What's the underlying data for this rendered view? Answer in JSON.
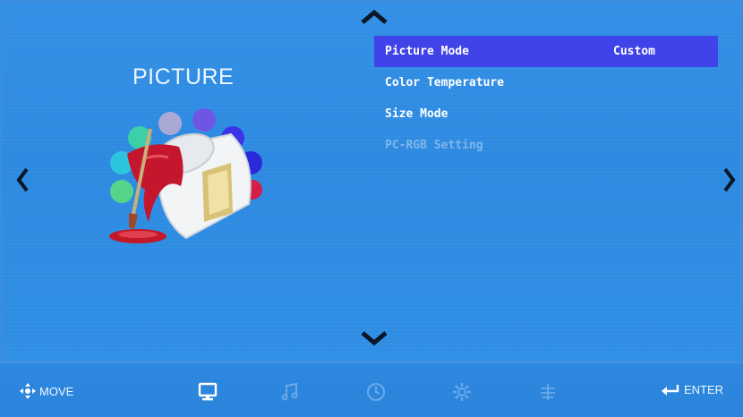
{
  "screen": {
    "section_title": "PICTURE"
  },
  "menu": {
    "items": [
      {
        "label": "Picture Mode",
        "value": "Custom",
        "state": "selected"
      },
      {
        "label": "Color Temperature",
        "value": "",
        "state": "normal"
      },
      {
        "label": "Size Mode",
        "value": "",
        "state": "normal"
      },
      {
        "label": "PC-RGB Setting",
        "value": "",
        "state": "disabled"
      }
    ]
  },
  "navigation": {
    "up_icon": "chevron-up-icon",
    "down_icon": "chevron-down-icon",
    "left_icon": "chevron-left-icon",
    "right_icon": "chevron-right-icon"
  },
  "bottom_bar": {
    "move_label": "MOVE",
    "enter_label": "ENTER",
    "tabs": [
      {
        "icon": "monitor-icon",
        "active": true
      },
      {
        "icon": "music-note-icon",
        "active": false
      },
      {
        "icon": "clock-icon",
        "active": false
      },
      {
        "icon": "settings-gear-icon",
        "active": false
      },
      {
        "icon": "options-icon",
        "active": false
      }
    ]
  },
  "colors": {
    "background": "#2f8ae0",
    "selection": "#3f43e8",
    "text": "#ffffff",
    "disabled_text": "#7fb6ea",
    "active_tab": "#ffffff",
    "inactive_tab": "#6aa9e6"
  }
}
